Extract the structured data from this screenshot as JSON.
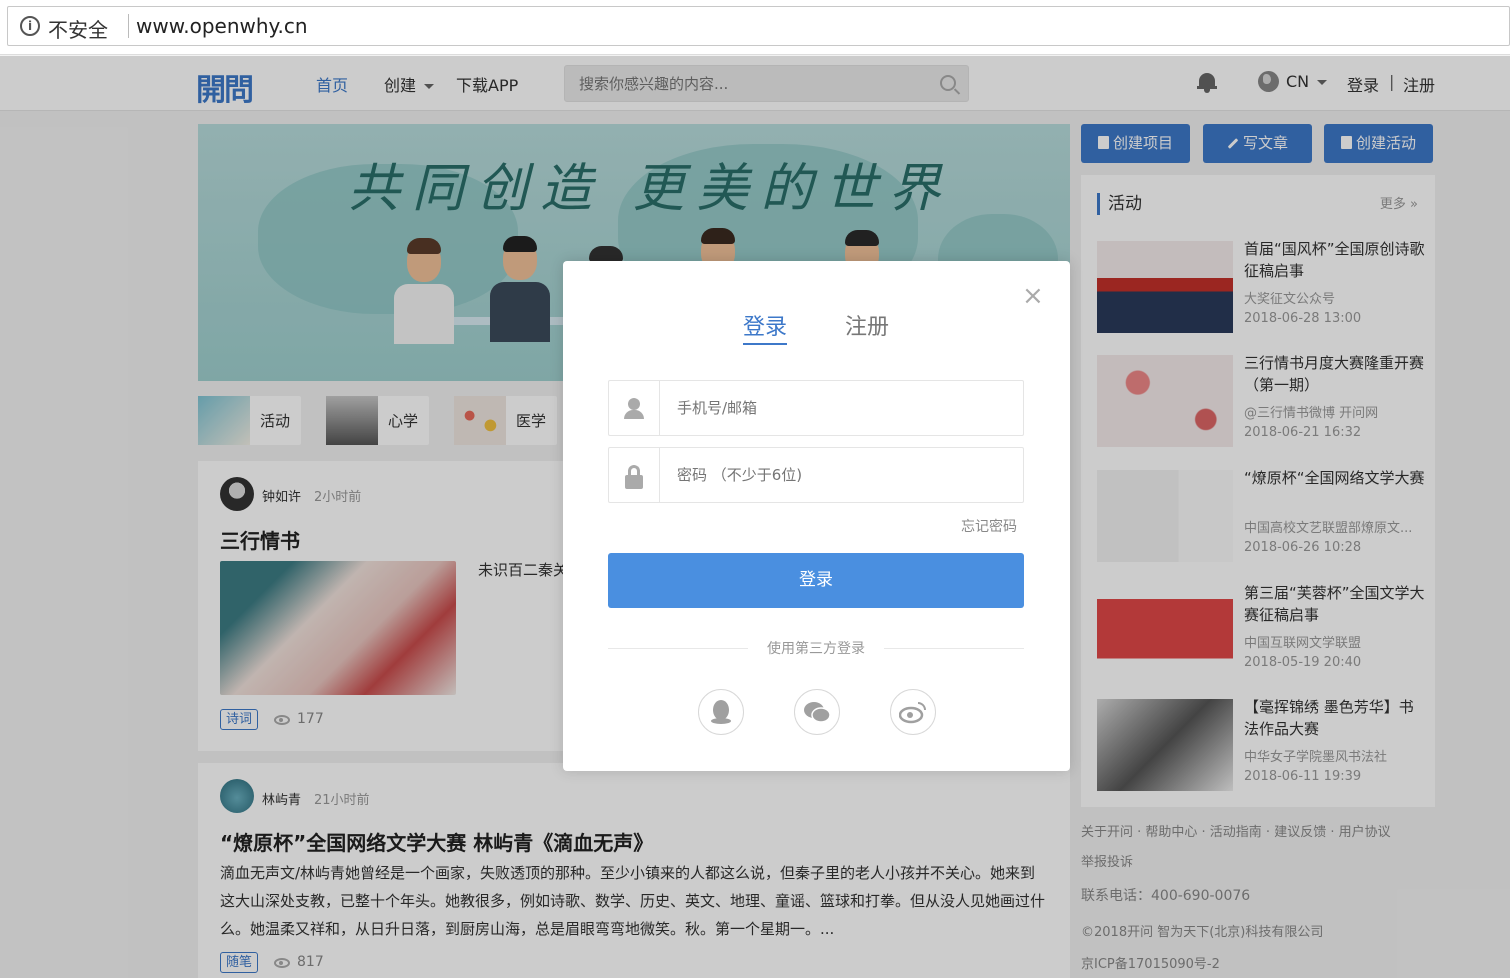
{
  "browser": {
    "info_icon": "i",
    "security_label": "不安全",
    "url": "www.openwhy.cn"
  },
  "header": {
    "logo": "開問",
    "nav": {
      "home": "首页",
      "create": "创建",
      "download": "下载APP"
    },
    "search_placeholder": "搜索你感兴趣的内容...",
    "lang": "CN",
    "login": "登录",
    "sep": "|",
    "register": "注册",
    "accent": "#3d78c9"
  },
  "hero": {
    "title": "共同创造 更美的世界"
  },
  "categories": [
    {
      "label": "活动"
    },
    {
      "label": "心学"
    },
    {
      "label": "医学"
    }
  ],
  "cards": [
    {
      "user": "钟如许",
      "time": "2小时前",
      "title": "三行情书",
      "excerpt": "未识百二秦关",
      "tag": "诗词",
      "views": "177"
    },
    {
      "user": "林屿青",
      "time": "21小时前",
      "title": "“燎原杯”全国网络文学大赛 林屿青《滴血无声》",
      "body": "滴血无声文/林屿青她曾经是一个画家，失败透顶的那种。至少小镇来的人都这么说，但秦子里的老人小孩并不关心。她来到这大山深处支教，已整十个年头。她教很多，例如诗歌、数学、历史、英文、地理、童谣、篮球和打拳。但从没人见她画过什么。她温柔又祥和，从日升日落，到厨房山海，总是眉眼弯弯地微笑。秋。第一个星期一。...",
      "tag": "随笔",
      "views": "817"
    }
  ],
  "right_buttons": {
    "create_project": "创建项目",
    "write_article": "写文章",
    "create_activity": "创建活动"
  },
  "activities": {
    "title": "活动",
    "more": "更多 »",
    "items": [
      {
        "title": "首届“国风杯”全国原创诗歌征稿启事",
        "source": "大奖征文公众号",
        "date": "2018-06-28 13:00"
      },
      {
        "title": "三行情书月度大赛隆重开赛（第一期）",
        "source": "@三行情书微博 开问网",
        "date": "2018-06-21 16:32"
      },
      {
        "title": "“燎原杯“全国网络文学大赛",
        "source": "中国高校文艺联盟部燎原文...",
        "date": "2018-06-26 10:28"
      },
      {
        "title": "第三届“芙蓉杯”全国文学大赛征稿启事",
        "source": "中国互联网文学联盟",
        "date": "2018-05-19 20:40"
      },
      {
        "title": "【毫挥锦绣 墨色芳华】书法作品大赛",
        "source": "中华女子学院墨风书法社",
        "date": "2018-06-11 19:39"
      }
    ]
  },
  "footer": {
    "links": "关于开问 · 帮助中心 · 活动指南 · 建议反馈 · 用户协议",
    "report": "举报投诉",
    "phone": "联系电话：400-690-0076",
    "copyright": "©2018开问 智为天下(北京)科技有限公司",
    "icp": "京ICP备17015090号-2"
  },
  "modal": {
    "close": "×",
    "tab_login": "登录",
    "tab_register": "注册",
    "account_placeholder": "手机号/邮箱",
    "password_placeholder": "密码 （不少于6位)",
    "forgot": "忘记密码",
    "login_button": "登录",
    "third_party": "使用第三方登录",
    "button_color": "#4a8fe0"
  }
}
